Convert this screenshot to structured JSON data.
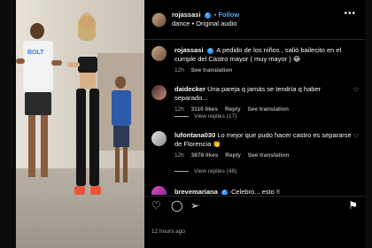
{
  "header": {
    "username": "rojassasi",
    "follow_label": "Follow",
    "subtitle": "dance • Original audio"
  },
  "caption": {
    "username": "rojassasi",
    "text": "A pedido de los niños , salió bailecito en el cumple del Castro mayor ( muy mayor ) 😂",
    "time": "12h",
    "translation": "See translation"
  },
  "comments": [
    {
      "username": "daidecker",
      "text": "Una pareja q jamás se tendría q haber separado...",
      "time": "12h",
      "likes": "3110 likes",
      "reply": "Reply",
      "translation": "See translation",
      "view_replies": "View replies (17)"
    },
    {
      "username": "lufontana030",
      "text": "Lo mejor que pudo hacer castro es separarse de Florencia 👏",
      "time": "12h",
      "likes": "3878 likes",
      "reply": "Reply",
      "translation": "See translation",
      "view_replies": "View replies (48)"
    },
    {
      "username": "brevemariana",
      "text": "Celebro... esto !!",
      "time": "",
      "likes": "",
      "reply": "",
      "translation": "",
      "view_replies": ""
    }
  ],
  "footer": {
    "timestamp": "12 hours ago"
  },
  "colors": {
    "accent": "#4aa8ff",
    "verified": "#3897f0",
    "muted": "#a8a8a8"
  },
  "icons": [
    "more-icon",
    "heart-icon",
    "comment-icon",
    "share-icon",
    "bookmark-icon",
    "verified-icon"
  ]
}
